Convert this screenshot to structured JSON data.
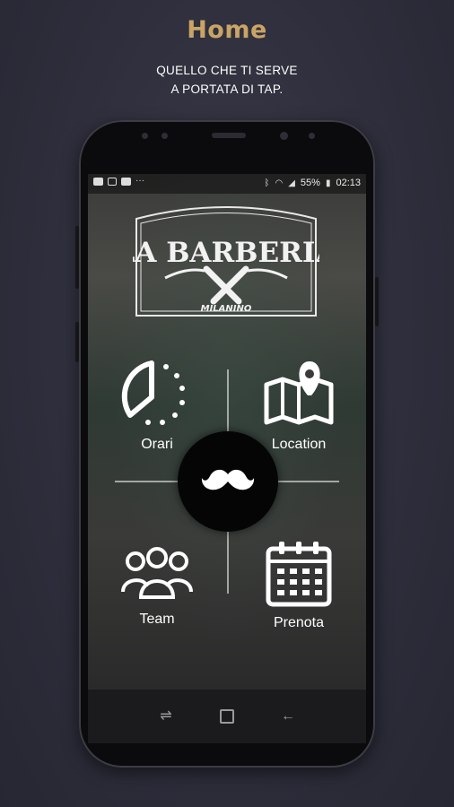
{
  "hero": {
    "title": "Home",
    "subtitle_line1": "QUELLO CHE TI SERVE",
    "subtitle_line2": "A PORTATA DI TAP."
  },
  "status_bar": {
    "battery": "55%",
    "time": "02:13",
    "left_icons": [
      "gallery-icon",
      "instagram-icon",
      "youtube-icon"
    ],
    "right_icons": [
      "bluetooth-icon",
      "wifi-icon",
      "signal-icon",
      "battery-icon"
    ]
  },
  "logo": {
    "line1": "LA BARBERIA",
    "line2": "MILANINO"
  },
  "menu": {
    "orari": "Orari",
    "location": "Location",
    "team": "Team",
    "prenota": "Prenota"
  },
  "nav": {
    "recents_icon": "recents-icon",
    "home_icon": "home-icon",
    "back_icon": "back-icon"
  },
  "colors": {
    "accent": "#c9a464",
    "background": "#2e2e3c",
    "phone": "#0b0b0d"
  }
}
